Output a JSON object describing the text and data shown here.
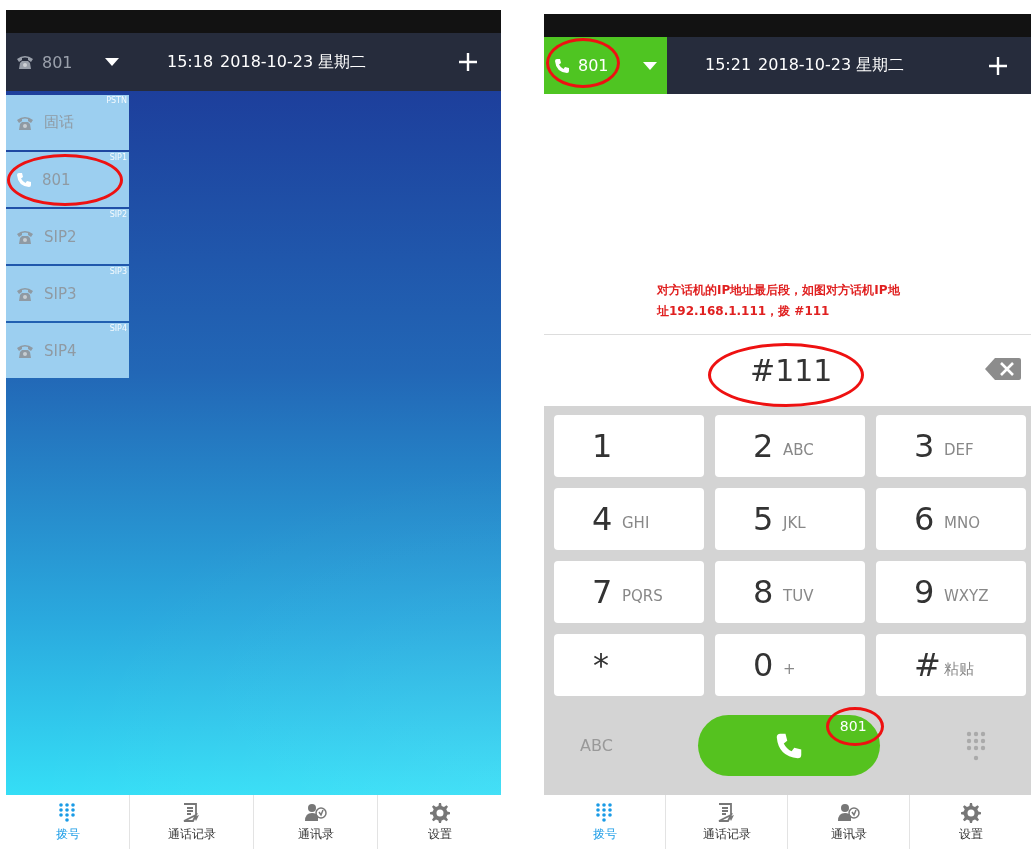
{
  "screens": [
    {
      "header": {
        "account": "801",
        "handset_icon": false,
        "active": false,
        "circled": false,
        "time": "15:18",
        "date": "2018-10-23 星期二"
      },
      "accounts": [
        {
          "name": "固话",
          "tag": "PSTN",
          "kind": "landline",
          "circled": false
        },
        {
          "name": "801",
          "tag": "SIP1",
          "kind": "handset",
          "circled": true
        },
        {
          "name": "SIP2",
          "tag": "SIP2",
          "kind": "landline",
          "circled": false
        },
        {
          "name": "SIP3",
          "tag": "SIP3",
          "kind": "landline",
          "circled": false
        },
        {
          "name": "SIP4",
          "tag": "SIP4",
          "kind": "landline",
          "circled": false
        }
      ],
      "tabs": [
        {
          "label": "拨号",
          "kind": "dialpad",
          "selected": true
        },
        {
          "label": "通话记录",
          "kind": "log",
          "selected": false
        },
        {
          "label": "通讯录",
          "kind": "contacts",
          "selected": false
        },
        {
          "label": "设置",
          "kind": "settings",
          "selected": false
        }
      ]
    },
    {
      "header": {
        "account": "801",
        "handset_icon": true,
        "active": true,
        "circled": true,
        "time": "15:21",
        "date": "2018-10-23 星期二"
      },
      "note": "对方话机的IP地址最后段，如图对方话机IP地址192.168.1.111，拨 #111",
      "dial_field": {
        "value": "#111",
        "circled": true
      },
      "keys": [
        {
          "digit": "1"
        },
        {
          "digit": "2",
          "letters": "ABC"
        },
        {
          "digit": "3",
          "letters": "DEF"
        },
        {
          "digit": "4",
          "letters": "GHI"
        },
        {
          "digit": "5",
          "letters": "JKL"
        },
        {
          "digit": "6",
          "letters": "MNO"
        },
        {
          "digit": "7",
          "letters": "PQRS"
        },
        {
          "digit": "8",
          "letters": "TUV"
        },
        {
          "digit": "9",
          "letters": "WXYZ"
        },
        {
          "digit": "*"
        },
        {
          "digit": "0",
          "letters": "+"
        },
        {
          "digit": "#",
          "letters": "粘贴"
        }
      ],
      "call_row": {
        "mode": "ABC",
        "badge": "801",
        "badge_circled": true
      },
      "tabs": [
        {
          "label": "拨号",
          "kind": "dialpad",
          "selected": true
        },
        {
          "label": "通话记录",
          "kind": "log",
          "selected": false
        },
        {
          "label": "通讯录",
          "kind": "contacts",
          "selected": false
        },
        {
          "label": "设置",
          "kind": "settings",
          "selected": false
        }
      ]
    }
  ]
}
